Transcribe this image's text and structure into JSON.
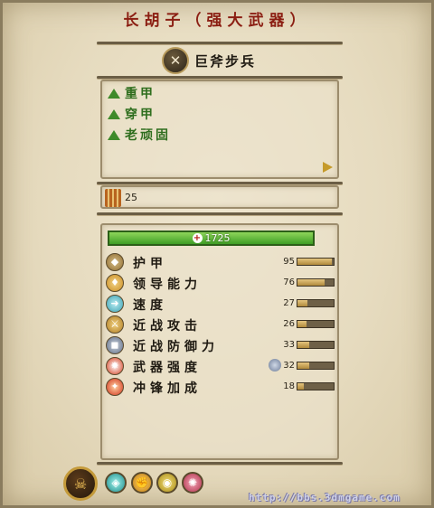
{
  "title": "长胡子（强大武器）",
  "unit": {
    "name": "巨斧步兵",
    "icon": "axe-icon"
  },
  "traits": [
    {
      "label": "重甲",
      "icon": "green-triangle-icon"
    },
    {
      "label": "穿甲",
      "icon": "green-triangle-icon"
    },
    {
      "label": "老顽固",
      "icon": "green-triangle-icon"
    }
  ],
  "ammo": {
    "value": "25",
    "icon": "ammo-icon"
  },
  "health": {
    "text": "1725",
    "icon": "health-plus-icon",
    "fraction": 1.0
  },
  "stats": [
    {
      "label": "护甲",
      "value": "95",
      "icon": "armor-icon",
      "fill": 0.95
    },
    {
      "label": "领导能力",
      "value": "76",
      "icon": "leadership-icon",
      "fill": 0.76
    },
    {
      "label": "速度",
      "value": "27",
      "icon": "speed-icon",
      "fill": 0.27
    },
    {
      "label": "近战攻击",
      "value": "26",
      "icon": "melee-attack-icon",
      "fill": 0.26
    },
    {
      "label": "近战防御力",
      "value": "33",
      "icon": "melee-defense-icon",
      "fill": 0.33
    },
    {
      "label": "武器强度",
      "value": "32",
      "icon": "weapon-strength-icon",
      "fill": 0.32
    },
    {
      "label": "冲锋加成",
      "value": "18",
      "icon": "charge-bonus-icon",
      "fill": 0.18
    }
  ],
  "bottom_icons": [
    "faction-emblem-icon",
    "ability-shield-icon",
    "ability-fist-icon",
    "ability-eye-icon",
    "ability-rune-icon"
  ],
  "watermark": "http://bbs.3dmgame.com"
}
